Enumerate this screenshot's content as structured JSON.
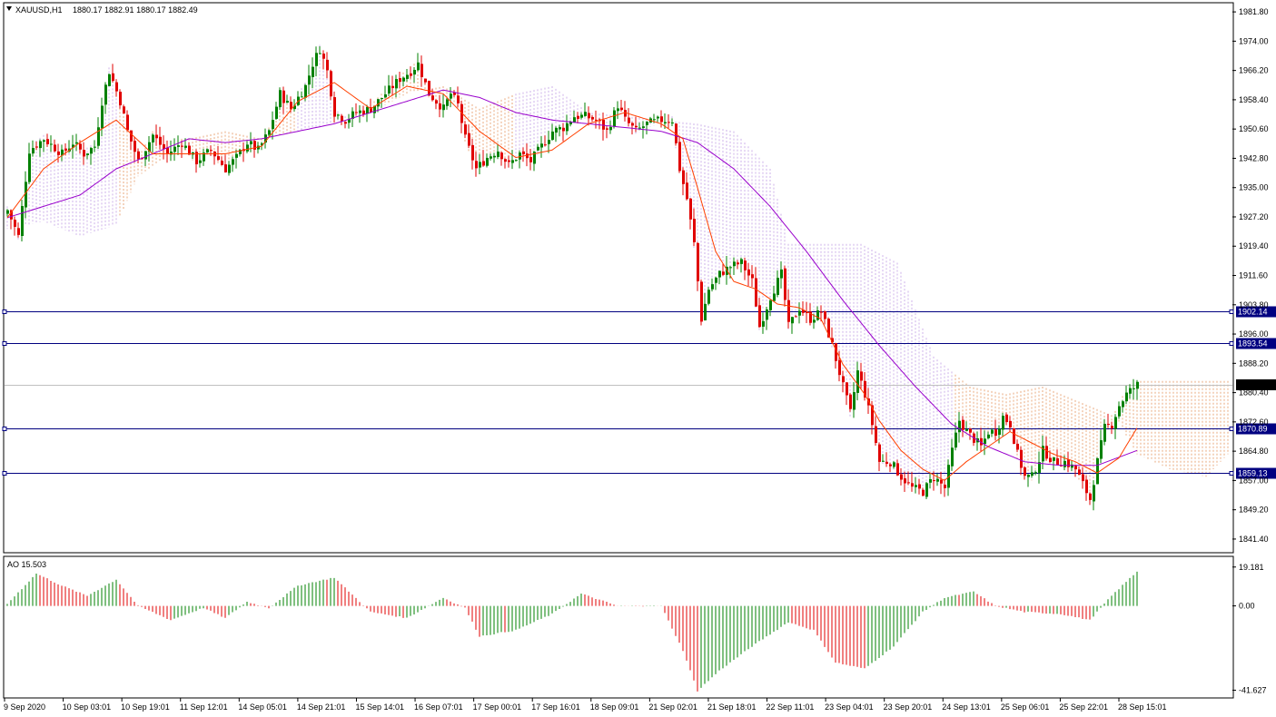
{
  "header": {
    "symbol": "XAUUSD,H1",
    "ohlc": "1880.17 1882.91 1880.17 1882.49"
  },
  "indicator": {
    "label": "AO 15.503",
    "y_ticks": [
      "19.181",
      "0.00",
      "-41.627"
    ],
    "y_values": [
      19.181,
      0,
      -41.627
    ],
    "range": [
      -45,
      24
    ]
  },
  "colors": {
    "bull": "#008000",
    "bear": "#e00000",
    "ma_fast": "#ff4000",
    "ma_slow": "#9900cc",
    "cloud_a": "#e8a070",
    "cloud_b": "#c8a8e8",
    "hline": "#000080",
    "label_bg": "#000080"
  },
  "chart_data": {
    "type": "candlestick",
    "symbol": "XAUUSD",
    "timeframe": "H1",
    "ylim": [
      1838,
      1984
    ],
    "y_ticks": [
      1981.8,
      1974.0,
      1966.2,
      1958.4,
      1950.6,
      1942.8,
      1935.0,
      1927.2,
      1919.4,
      1911.6,
      1903.8,
      1896.0,
      1888.2,
      1880.4,
      1872.6,
      1864.8,
      1857.0,
      1849.2,
      1841.4
    ],
    "y_tick_labels": [
      "1981.80",
      "1974.00",
      "1966.20",
      "1958.40",
      "1950.60",
      "1942.80",
      "1935.00",
      "1927.20",
      "1919.40",
      "1911.60",
      "1903.80",
      "1896.00",
      "1888.20",
      "1880.40",
      "1872.60",
      "1864.80",
      "1857.00",
      "1849.20",
      "1841.40"
    ],
    "x_labels": [
      "9 Sep 2020",
      "10 Sep 03:01",
      "10 Sep 19:01",
      "11 Sep 12:01",
      "14 Sep 05:01",
      "14 Sep 21:01",
      "15 Sep 14:01",
      "16 Sep 07:01",
      "17 Sep 00:01",
      "17 Sep 16:01",
      "18 Sep 09:01",
      "21 Sep 02:01",
      "21 Sep 18:01",
      "22 Sep 11:01",
      "23 Sep 04:01",
      "23 Sep 20:01",
      "24 Sep 13:01",
      "25 Sep 06:01",
      "25 Sep 22:01",
      "28 Sep 15:01"
    ],
    "close_path": [
      [
        0,
        1929
      ],
      [
        3,
        1922
      ],
      [
        6,
        1945
      ],
      [
        10,
        1948
      ],
      [
        15,
        1944
      ],
      [
        18,
        1947
      ],
      [
        21,
        1944
      ],
      [
        24,
        1946
      ],
      [
        26,
        1958
      ],
      [
        28,
        1966
      ],
      [
        31,
        1958
      ],
      [
        33,
        1950
      ],
      [
        36,
        1942
      ],
      [
        40,
        1949
      ],
      [
        44,
        1944
      ],
      [
        48,
        1947
      ],
      [
        52,
        1942
      ],
      [
        56,
        1945
      ],
      [
        60,
        1940
      ],
      [
        63,
        1943
      ],
      [
        66,
        1947
      ],
      [
        69,
        1945
      ],
      [
        72,
        1950
      ],
      [
        75,
        1960
      ],
      [
        78,
        1956
      ],
      [
        82,
        1962
      ],
      [
        84,
        1968
      ],
      [
        86,
        1972
      ],
      [
        88,
        1966
      ],
      [
        90,
        1955
      ],
      [
        93,
        1953
      ],
      [
        96,
        1955
      ],
      [
        100,
        1956
      ],
      [
        104,
        1960
      ],
      [
        108,
        1964
      ],
      [
        111,
        1966
      ],
      [
        113,
        1968
      ],
      [
        116,
        1960
      ],
      [
        118,
        1958
      ],
      [
        120,
        1956
      ],
      [
        122,
        1960
      ],
      [
        124,
        1957
      ],
      [
        126,
        1948
      ],
      [
        129,
        1940
      ],
      [
        132,
        1943
      ],
      [
        135,
        1945
      ],
      [
        138,
        1941
      ],
      [
        141,
        1944
      ],
      [
        144,
        1942
      ],
      [
        147,
        1946
      ],
      [
        150,
        1950
      ],
      [
        153,
        1951
      ],
      [
        156,
        1954
      ],
      [
        159,
        1954
      ],
      [
        162,
        1953
      ],
      [
        165,
        1950
      ],
      [
        168,
        1957
      ],
      [
        170,
        1953
      ],
      [
        173,
        1950
      ],
      [
        176,
        1952
      ],
      [
        180,
        1953
      ],
      [
        183,
        1953
      ],
      [
        185,
        1940
      ],
      [
        187,
        1932
      ],
      [
        189,
        1920
      ],
      [
        191,
        1900
      ],
      [
        193,
        1908
      ],
      [
        196,
        1912
      ],
      [
        199,
        1914
      ],
      [
        202,
        1915
      ],
      [
        205,
        1910
      ],
      [
        207,
        1898
      ],
      [
        210,
        1906
      ],
      [
        213,
        1912
      ],
      [
        215,
        1898
      ],
      [
        218,
        1903
      ],
      [
        221,
        1900
      ],
      [
        224,
        1902
      ],
      [
        227,
        1893
      ],
      [
        230,
        1882
      ],
      [
        232,
        1875
      ],
      [
        234,
        1886
      ],
      [
        236,
        1880
      ],
      [
        238,
        1872
      ],
      [
        240,
        1862
      ],
      [
        243,
        1862
      ],
      [
        246,
        1858
      ],
      [
        249,
        1855
      ],
      [
        252,
        1854
      ],
      [
        255,
        1858
      ],
      [
        258,
        1855
      ],
      [
        260,
        1865
      ],
      [
        262,
        1873
      ],
      [
        264,
        1870
      ],
      [
        266,
        1868
      ],
      [
        268,
        1866
      ],
      [
        270,
        1870
      ],
      [
        272,
        1870
      ],
      [
        274,
        1874
      ],
      [
        276,
        1872
      ],
      [
        278,
        1864
      ],
      [
        280,
        1858
      ],
      [
        282,
        1858
      ],
      [
        285,
        1865
      ],
      [
        288,
        1862
      ],
      [
        291,
        1862
      ],
      [
        294,
        1860
      ],
      [
        296,
        1856
      ],
      [
        298,
        1852
      ],
      [
        300,
        1862
      ],
      [
        302,
        1871
      ],
      [
        304,
        1872
      ],
      [
        306,
        1877
      ],
      [
        308,
        1880
      ],
      [
        311,
        1882.49
      ]
    ],
    "ma_fast_path": [
      [
        0,
        1927
      ],
      [
        10,
        1940
      ],
      [
        20,
        1947
      ],
      [
        30,
        1953
      ],
      [
        40,
        1944
      ],
      [
        50,
        1944
      ],
      [
        60,
        1944
      ],
      [
        70,
        1946
      ],
      [
        80,
        1958
      ],
      [
        90,
        1963
      ],
      [
        100,
        1956
      ],
      [
        110,
        1962
      ],
      [
        120,
        1960
      ],
      [
        130,
        1950
      ],
      [
        140,
        1943
      ],
      [
        150,
        1945
      ],
      [
        160,
        1952
      ],
      [
        170,
        1955
      ],
      [
        180,
        1952
      ],
      [
        186,
        1948
      ],
      [
        190,
        1935
      ],
      [
        195,
        1918
      ],
      [
        200,
        1910
      ],
      [
        206,
        1908
      ],
      [
        212,
        1904
      ],
      [
        218,
        1903
      ],
      [
        224,
        1900
      ],
      [
        230,
        1888
      ],
      [
        236,
        1880
      ],
      [
        240,
        1873
      ],
      [
        246,
        1865
      ],
      [
        252,
        1860
      ],
      [
        258,
        1857
      ],
      [
        264,
        1862
      ],
      [
        270,
        1866
      ],
      [
        276,
        1870
      ],
      [
        282,
        1867
      ],
      [
        288,
        1864
      ],
      [
        294,
        1862
      ],
      [
        300,
        1859
      ],
      [
        306,
        1863
      ],
      [
        311,
        1871
      ]
    ],
    "ma_slow_path": [
      [
        0,
        1927
      ],
      [
        20,
        1933
      ],
      [
        30,
        1940
      ],
      [
        40,
        1944
      ],
      [
        50,
        1948
      ],
      [
        60,
        1947
      ],
      [
        70,
        1948
      ],
      [
        80,
        1950
      ],
      [
        90,
        1952
      ],
      [
        100,
        1955
      ],
      [
        110,
        1958
      ],
      [
        120,
        1961
      ],
      [
        130,
        1959
      ],
      [
        140,
        1955
      ],
      [
        150,
        1953
      ],
      [
        160,
        1952
      ],
      [
        170,
        1951
      ],
      [
        180,
        1950
      ],
      [
        190,
        1947
      ],
      [
        200,
        1940
      ],
      [
        210,
        1930
      ],
      [
        220,
        1918
      ],
      [
        230,
        1905
      ],
      [
        240,
        1893
      ],
      [
        250,
        1882
      ],
      [
        260,
        1872
      ],
      [
        270,
        1866
      ],
      [
        280,
        1862
      ],
      [
        290,
        1861
      ],
      [
        300,
        1861
      ],
      [
        311,
        1865
      ]
    ],
    "cloud_path": [
      [
        0,
        1924
      ],
      [
        10,
        1926
      ],
      [
        20,
        1922
      ],
      [
        30,
        1925
      ],
      [
        36,
        1938
      ],
      [
        42,
        1942
      ],
      [
        50,
        1948
      ],
      [
        60,
        1950
      ],
      [
        70,
        1948
      ],
      [
        80,
        1950
      ],
      [
        90,
        1952
      ],
      [
        100,
        1955
      ],
      [
        110,
        1960
      ],
      [
        120,
        1962
      ],
      [
        130,
        1956
      ],
      [
        140,
        1960
      ],
      [
        150,
        1962
      ],
      [
        160,
        1955
      ],
      [
        170,
        1954
      ],
      [
        180,
        1953
      ],
      [
        190,
        1952
      ],
      [
        200,
        1950
      ],
      [
        210,
        1940
      ],
      [
        215,
        1920
      ],
      [
        225,
        1920
      ],
      [
        235,
        1920
      ],
      [
        245,
        1915
      ],
      [
        255,
        1890
      ],
      [
        265,
        1882
      ],
      [
        275,
        1880
      ],
      [
        285,
        1882
      ],
      [
        295,
        1878
      ],
      [
        305,
        1874
      ],
      [
        311,
        1864
      ],
      [
        320,
        1860
      ],
      [
        330,
        1858
      ],
      [
        340,
        1868
      ]
    ],
    "ao_path": [
      [
        0,
        1
      ],
      [
        8,
        16
      ],
      [
        15,
        10
      ],
      [
        22,
        5
      ],
      [
        30,
        13
      ],
      [
        36,
        0
      ],
      [
        45,
        -7
      ],
      [
        54,
        -1
      ],
      [
        60,
        -6
      ],
      [
        66,
        2
      ],
      [
        72,
        -1
      ],
      [
        80,
        10
      ],
      [
        90,
        14
      ],
      [
        100,
        -3
      ],
      [
        110,
        -6
      ],
      [
        120,
        4
      ],
      [
        126,
        -1
      ],
      [
        130,
        -15
      ],
      [
        140,
        -12
      ],
      [
        150,
        -4
      ],
      [
        158,
        6
      ],
      [
        168,
        0
      ],
      [
        180,
        0
      ],
      [
        186,
        -22
      ],
      [
        190,
        -42
      ],
      [
        196,
        -32
      ],
      [
        205,
        -20
      ],
      [
        215,
        -8
      ],
      [
        222,
        -12
      ],
      [
        228,
        -28
      ],
      [
        236,
        -31
      ],
      [
        244,
        -20
      ],
      [
        252,
        -3
      ],
      [
        258,
        4
      ],
      [
        266,
        7
      ],
      [
        272,
        0
      ],
      [
        280,
        -3
      ],
      [
        290,
        -4
      ],
      [
        298,
        -7
      ],
      [
        304,
        5
      ],
      [
        311,
        17
      ]
    ],
    "price_bubble": "1882.49",
    "horizontal_lines": [
      {
        "value": 1902.14,
        "label": "1902.14"
      },
      {
        "value": 1893.54,
        "label": "1893.54"
      },
      {
        "value": 1870.89,
        "label": "1870.89"
      },
      {
        "value": 1859.13,
        "label": "1859.13"
      }
    ]
  }
}
